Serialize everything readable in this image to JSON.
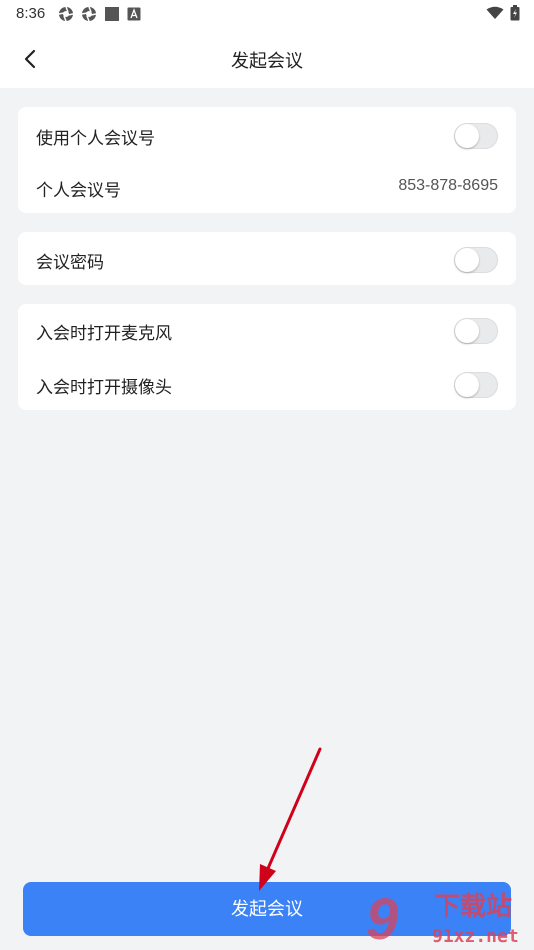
{
  "status_bar": {
    "time": "8:36"
  },
  "header": {
    "title": "发起会议"
  },
  "personal_meeting": {
    "use_label": "使用个人会议号",
    "use_enabled": false,
    "id_label": "个人会议号",
    "id_value": "853-878-8695"
  },
  "password": {
    "label": "会议密码",
    "enabled": false
  },
  "join_options": {
    "mic_label": "入会时打开麦克风",
    "mic_enabled": false,
    "camera_label": "入会时打开摄像头",
    "camera_enabled": false
  },
  "footer": {
    "start_label": "发起会议"
  },
  "watermark": {
    "brand": "下载站",
    "domain": "91xz.net",
    "logo_glyph": "9"
  },
  "colors": {
    "accent": "#3b82f6",
    "toggle_off": "#e9eaec",
    "annotation_arrow": "#d0021b",
    "watermark": "#d9435b"
  }
}
